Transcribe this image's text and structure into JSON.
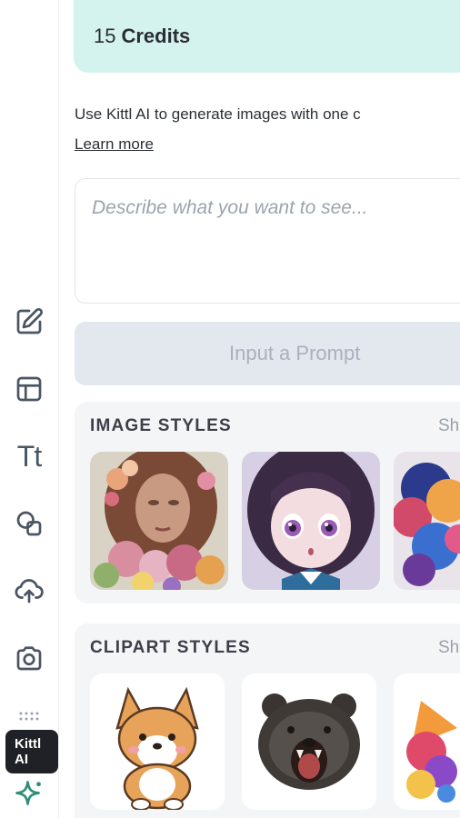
{
  "credits": {
    "count": "15",
    "label": "Credits"
  },
  "intro": {
    "text": "Use Kittl AI to generate images with one c",
    "learn_more": "Learn more"
  },
  "prompt": {
    "placeholder": "Describe what you want to see..."
  },
  "generate_button": {
    "label": "Input a Prompt"
  },
  "image_styles": {
    "title": "IMAGE STYLES",
    "show_all": "Sh",
    "items": [
      "flower-portrait-thumbnail",
      "anime-girl-thumbnail",
      "colorful-portrait-thumbnail"
    ]
  },
  "clipart_styles": {
    "title": "CLIPART STYLES",
    "show_all": "Sh",
    "items": [
      "corgi-sticker-thumbnail",
      "bear-sticker-thumbnail",
      "colorful-fox-thumbnail"
    ]
  },
  "rail": {
    "tools": [
      "edit-icon",
      "layout-icon",
      "text-icon",
      "shapes-icon",
      "upload-icon",
      "camera-icon",
      "kittl-ai-icon"
    ],
    "text_tool_glyph": "Tt",
    "tooltip": "Kittl AI"
  },
  "colors": {
    "credits_bg": "#d5f3ee",
    "section_bg": "#f4f5f7",
    "button_disabled_bg": "#e3e7ee",
    "ai_accent": "#2f8f7a"
  }
}
